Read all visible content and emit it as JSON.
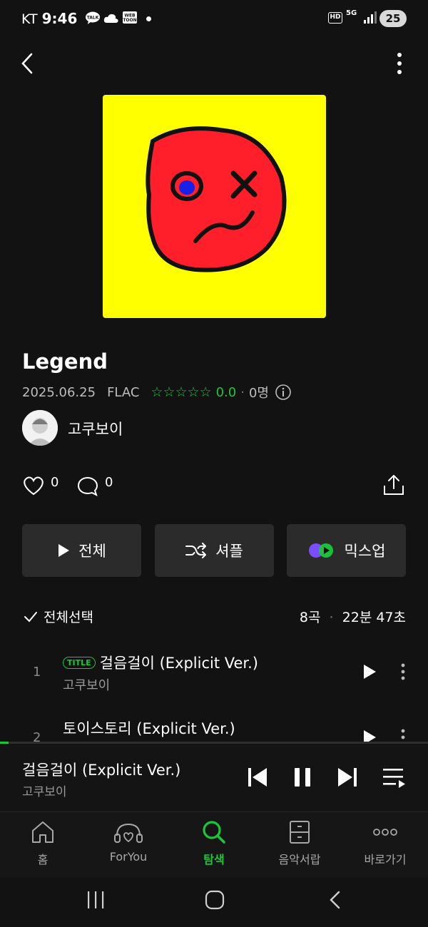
{
  "status_bar": {
    "carrier": "KT",
    "time": "9:46",
    "app_icons": [
      "talk-icon",
      "cloud-icon",
      "webtoon-icon",
      "dot-icon"
    ],
    "talk_label": "TALK",
    "webtoon_label": "WEB\nTOON",
    "hd_label": "HD",
    "network_label": "5G",
    "battery": "25"
  },
  "album": {
    "title": "Legend",
    "date": "2025.06.25",
    "format": "FLAC",
    "rating": "0.0",
    "rating_count": "0명",
    "artist": "고쿠보이",
    "likes": "0",
    "comments": "0"
  },
  "actions": {
    "play_all": "전체",
    "shuffle": "셔플",
    "mixup": "믹스업"
  },
  "tracklist": {
    "select_all": "전체선택",
    "count": "8곡",
    "separator": "·",
    "duration": "22분 47초",
    "tracks": [
      {
        "no": "1",
        "badge": "TITLE",
        "title": "걸음걸이 (Explicit Ver.)",
        "artist": "고쿠보이"
      },
      {
        "no": "2",
        "badge": "",
        "title": "토이스토리 (Explicit Ver.)",
        "artist": ""
      }
    ]
  },
  "now_playing": {
    "title": "걸음걸이 (Explicit Ver.)",
    "artist": "고쿠보이",
    "progress": 0.02
  },
  "bottom_nav": [
    {
      "label": "홈",
      "icon": "home-icon",
      "active": false
    },
    {
      "label": "ForYou",
      "icon": "foryou-icon",
      "active": false
    },
    {
      "label": "탐색",
      "icon": "search-icon",
      "active": true
    },
    {
      "label": "음악서랍",
      "icon": "drawer-icon",
      "active": false
    },
    {
      "label": "바로가기",
      "icon": "more-dots-icon",
      "active": false
    }
  ],
  "colors": {
    "accent": "#19c839",
    "cover_bg": "#ffff00",
    "face": "#ff2020",
    "background": "#121212"
  }
}
